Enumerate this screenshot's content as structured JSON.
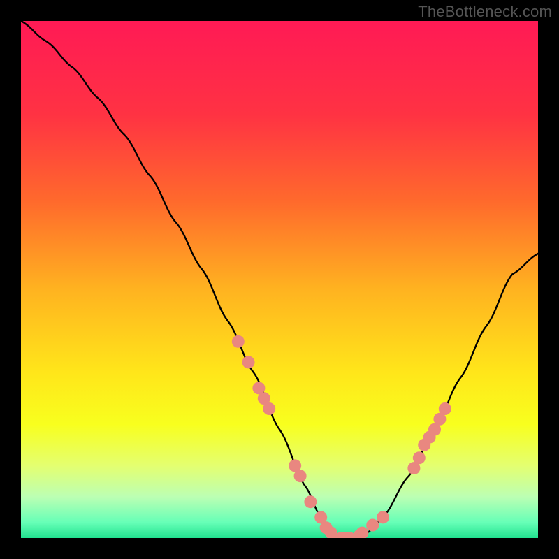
{
  "watermark": "TheBottleneck.com",
  "chart_data": {
    "type": "line",
    "title": "",
    "xlabel": "",
    "ylabel": "",
    "xlim": [
      0,
      100
    ],
    "ylim": [
      0,
      100
    ],
    "gradient_stops": [
      {
        "offset": 0,
        "color": "#ff1a55"
      },
      {
        "offset": 18,
        "color": "#ff3243"
      },
      {
        "offset": 35,
        "color": "#ff6a2c"
      },
      {
        "offset": 52,
        "color": "#ffb320"
      },
      {
        "offset": 68,
        "color": "#ffe61a"
      },
      {
        "offset": 78,
        "color": "#f8ff1e"
      },
      {
        "offset": 86,
        "color": "#e4ff70"
      },
      {
        "offset": 92,
        "color": "#bcffb3"
      },
      {
        "offset": 97,
        "color": "#66ffb7"
      },
      {
        "offset": 100,
        "color": "#21e28f"
      }
    ],
    "series": [
      {
        "name": "bottleneck-curve",
        "x": [
          0,
          5,
          10,
          15,
          20,
          25,
          30,
          35,
          40,
          45,
          50,
          55,
          58,
          60,
          62,
          64,
          67,
          70,
          75,
          80,
          85,
          90,
          95,
          100
        ],
        "y": [
          100,
          96,
          91,
          85,
          78,
          70,
          61,
          52,
          42,
          32,
          21,
          10,
          4,
          1,
          0,
          0,
          1,
          4,
          12,
          21,
          31,
          41,
          51,
          55
        ]
      }
    ],
    "markers": {
      "name": "highlight-dots",
      "color": "#e98780",
      "radius_px": 9,
      "points": [
        {
          "x": 42,
          "y": 38
        },
        {
          "x": 44,
          "y": 34
        },
        {
          "x": 46,
          "y": 29
        },
        {
          "x": 47,
          "y": 27
        },
        {
          "x": 48,
          "y": 25
        },
        {
          "x": 53,
          "y": 14
        },
        {
          "x": 54,
          "y": 12
        },
        {
          "x": 56,
          "y": 7
        },
        {
          "x": 58,
          "y": 4
        },
        {
          "x": 59,
          "y": 2
        },
        {
          "x": 60,
          "y": 1
        },
        {
          "x": 62,
          "y": 0
        },
        {
          "x": 63,
          "y": 0
        },
        {
          "x": 63.5,
          "y": 0
        },
        {
          "x": 65.5,
          "y": 0.5
        },
        {
          "x": 66,
          "y": 1
        },
        {
          "x": 68,
          "y": 2.5
        },
        {
          "x": 70,
          "y": 4
        },
        {
          "x": 76,
          "y": 13.5
        },
        {
          "x": 77,
          "y": 15.5
        },
        {
          "x": 78,
          "y": 18
        },
        {
          "x": 79,
          "y": 19.5
        },
        {
          "x": 80,
          "y": 21
        },
        {
          "x": 81,
          "y": 23
        },
        {
          "x": 82,
          "y": 25
        }
      ]
    }
  }
}
